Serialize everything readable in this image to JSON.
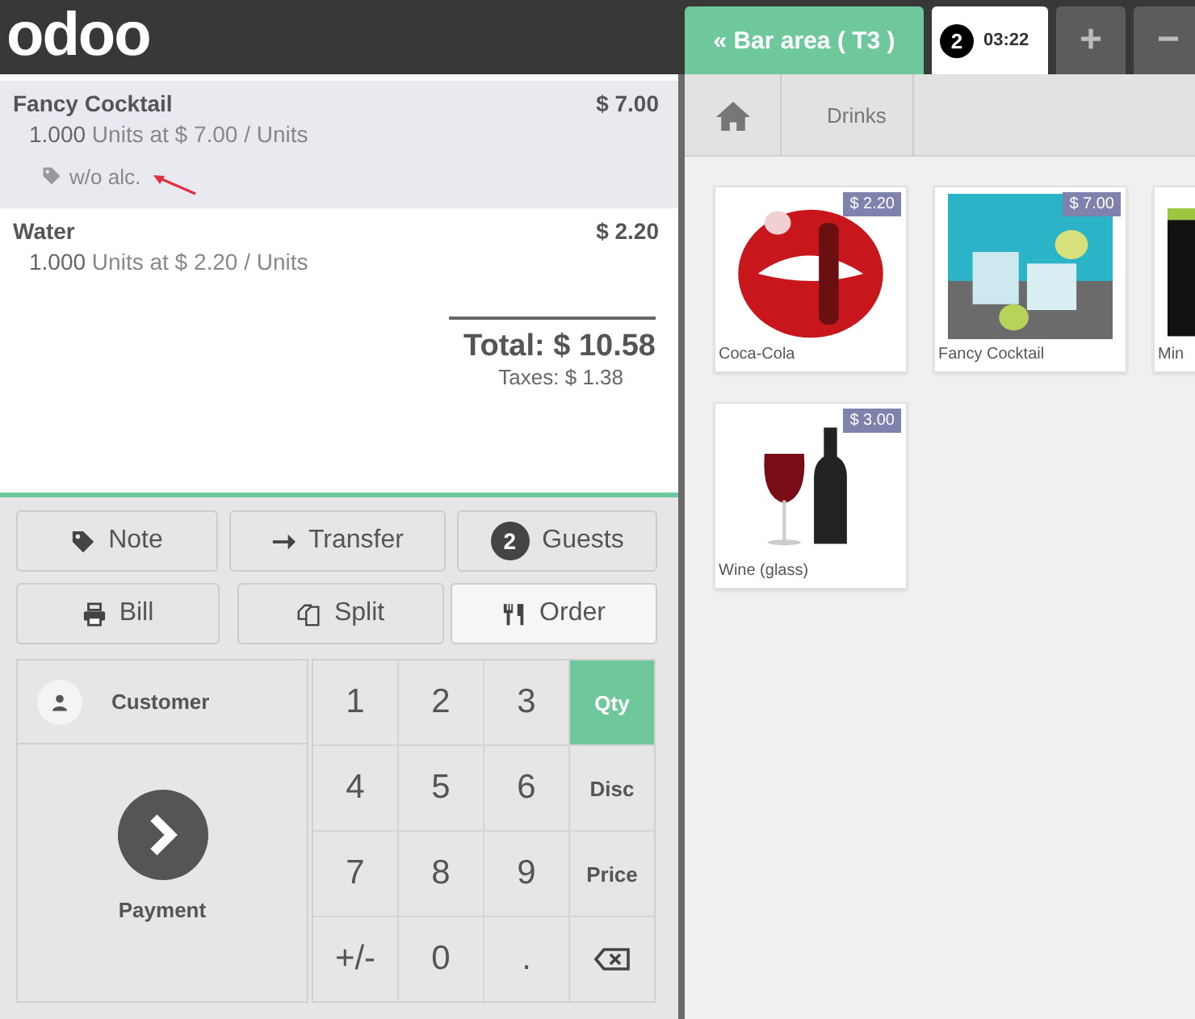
{
  "header": {
    "logo": "odoo",
    "back_tab": {
      "icon": "«",
      "label": "Bar area ( T3 )"
    },
    "order_tabs": [
      {
        "badge": "2",
        "time": "03:22",
        "selected": true
      }
    ],
    "actions": [
      "+",
      "−"
    ]
  },
  "order": {
    "lines": [
      {
        "name": "Fancy Cocktail",
        "price": "$ 7.00",
        "qty": "1.000",
        "detail": "Units at $ 7.00 / Units",
        "note": "w/o alc.",
        "selected": true
      },
      {
        "name": "Water",
        "price": "$ 2.20",
        "qty": "1.000",
        "detail": "Units at $ 2.20 / Units",
        "selected": false
      }
    ],
    "total": "Total: $ 10.58",
    "taxes": "Taxes: $ 1.38"
  },
  "control_buttons": [
    {
      "kind": "note",
      "label": "Note",
      "selected": false
    },
    {
      "kind": "transfer",
      "label": "Transfer",
      "selected": false
    },
    {
      "kind": "guests",
      "label": "Guests",
      "badge": "2",
      "selected": false
    },
    {
      "kind": "bill",
      "label": "Bill",
      "selected": false
    },
    {
      "kind": "split",
      "label": "Split",
      "selected": false
    },
    {
      "kind": "order",
      "label": "Order",
      "selected": true
    }
  ],
  "customer": "Customer",
  "payment": "Payment",
  "numpad": [
    {
      "kind": "digit",
      "label": "1"
    },
    {
      "kind": "digit",
      "label": "2"
    },
    {
      "kind": "digit",
      "label": "3"
    },
    {
      "kind": "mode",
      "label": "Qty",
      "selected": true
    },
    {
      "kind": "digit",
      "label": "4"
    },
    {
      "kind": "digit",
      "label": "5"
    },
    {
      "kind": "digit",
      "label": "6"
    },
    {
      "kind": "mode",
      "label": "Disc",
      "selected": false
    },
    {
      "kind": "digit",
      "label": "7"
    },
    {
      "kind": "digit",
      "label": "8"
    },
    {
      "kind": "digit",
      "label": "9"
    },
    {
      "kind": "mode",
      "label": "Price",
      "selected": false
    },
    {
      "kind": "digit",
      "label": "+/-"
    },
    {
      "kind": "digit",
      "label": "0"
    },
    {
      "kind": "digit",
      "label": "."
    },
    {
      "kind": "backspace"
    }
  ],
  "breadcrumb": [
    "Drinks"
  ],
  "products": [
    {
      "name": "Coca-Cola",
      "price": "$ 2.20",
      "kind": "picture"
    },
    {
      "name": "Fancy Cocktail",
      "price": "$ 7.00",
      "kind": "picture"
    },
    {
      "name": "Min",
      "kind": "picture"
    },
    {
      "name": "Wine (glass)",
      "price": "$ 3.00",
      "kind": "picture"
    }
  ]
}
